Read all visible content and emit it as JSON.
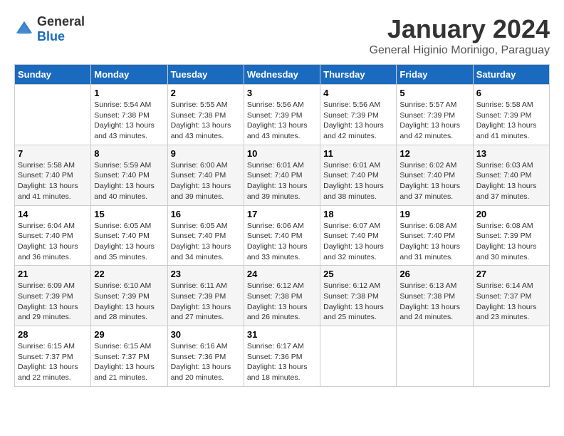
{
  "logo": {
    "general": "General",
    "blue": "Blue"
  },
  "title": "January 2024",
  "subtitle": "General Higinio Morinigo, Paraguay",
  "days_header": [
    "Sunday",
    "Monday",
    "Tuesday",
    "Wednesday",
    "Thursday",
    "Friday",
    "Saturday"
  ],
  "weeks": [
    [
      {
        "day": "",
        "info": ""
      },
      {
        "day": "1",
        "info": "Sunrise: 5:54 AM\nSunset: 7:38 PM\nDaylight: 13 hours\nand 43 minutes."
      },
      {
        "day": "2",
        "info": "Sunrise: 5:55 AM\nSunset: 7:38 PM\nDaylight: 13 hours\nand 43 minutes."
      },
      {
        "day": "3",
        "info": "Sunrise: 5:56 AM\nSunset: 7:39 PM\nDaylight: 13 hours\nand 43 minutes."
      },
      {
        "day": "4",
        "info": "Sunrise: 5:56 AM\nSunset: 7:39 PM\nDaylight: 13 hours\nand 42 minutes."
      },
      {
        "day": "5",
        "info": "Sunrise: 5:57 AM\nSunset: 7:39 PM\nDaylight: 13 hours\nand 42 minutes."
      },
      {
        "day": "6",
        "info": "Sunrise: 5:58 AM\nSunset: 7:39 PM\nDaylight: 13 hours\nand 41 minutes."
      }
    ],
    [
      {
        "day": "7",
        "info": "Sunrise: 5:58 AM\nSunset: 7:40 PM\nDaylight: 13 hours\nand 41 minutes."
      },
      {
        "day": "8",
        "info": "Sunrise: 5:59 AM\nSunset: 7:40 PM\nDaylight: 13 hours\nand 40 minutes."
      },
      {
        "day": "9",
        "info": "Sunrise: 6:00 AM\nSunset: 7:40 PM\nDaylight: 13 hours\nand 39 minutes."
      },
      {
        "day": "10",
        "info": "Sunrise: 6:01 AM\nSunset: 7:40 PM\nDaylight: 13 hours\nand 39 minutes."
      },
      {
        "day": "11",
        "info": "Sunrise: 6:01 AM\nSunset: 7:40 PM\nDaylight: 13 hours\nand 38 minutes."
      },
      {
        "day": "12",
        "info": "Sunrise: 6:02 AM\nSunset: 7:40 PM\nDaylight: 13 hours\nand 37 minutes."
      },
      {
        "day": "13",
        "info": "Sunrise: 6:03 AM\nSunset: 7:40 PM\nDaylight: 13 hours\nand 37 minutes."
      }
    ],
    [
      {
        "day": "14",
        "info": "Sunrise: 6:04 AM\nSunset: 7:40 PM\nDaylight: 13 hours\nand 36 minutes."
      },
      {
        "day": "15",
        "info": "Sunrise: 6:05 AM\nSunset: 7:40 PM\nDaylight: 13 hours\nand 35 minutes."
      },
      {
        "day": "16",
        "info": "Sunrise: 6:05 AM\nSunset: 7:40 PM\nDaylight: 13 hours\nand 34 minutes."
      },
      {
        "day": "17",
        "info": "Sunrise: 6:06 AM\nSunset: 7:40 PM\nDaylight: 13 hours\nand 33 minutes."
      },
      {
        "day": "18",
        "info": "Sunrise: 6:07 AM\nSunset: 7:40 PM\nDaylight: 13 hours\nand 32 minutes."
      },
      {
        "day": "19",
        "info": "Sunrise: 6:08 AM\nSunset: 7:40 PM\nDaylight: 13 hours\nand 31 minutes."
      },
      {
        "day": "20",
        "info": "Sunrise: 6:08 AM\nSunset: 7:39 PM\nDaylight: 13 hours\nand 30 minutes."
      }
    ],
    [
      {
        "day": "21",
        "info": "Sunrise: 6:09 AM\nSunset: 7:39 PM\nDaylight: 13 hours\nand 29 minutes."
      },
      {
        "day": "22",
        "info": "Sunrise: 6:10 AM\nSunset: 7:39 PM\nDaylight: 13 hours\nand 28 minutes."
      },
      {
        "day": "23",
        "info": "Sunrise: 6:11 AM\nSunset: 7:39 PM\nDaylight: 13 hours\nand 27 minutes."
      },
      {
        "day": "24",
        "info": "Sunrise: 6:12 AM\nSunset: 7:38 PM\nDaylight: 13 hours\nand 26 minutes."
      },
      {
        "day": "25",
        "info": "Sunrise: 6:12 AM\nSunset: 7:38 PM\nDaylight: 13 hours\nand 25 minutes."
      },
      {
        "day": "26",
        "info": "Sunrise: 6:13 AM\nSunset: 7:38 PM\nDaylight: 13 hours\nand 24 minutes."
      },
      {
        "day": "27",
        "info": "Sunrise: 6:14 AM\nSunset: 7:37 PM\nDaylight: 13 hours\nand 23 minutes."
      }
    ],
    [
      {
        "day": "28",
        "info": "Sunrise: 6:15 AM\nSunset: 7:37 PM\nDaylight: 13 hours\nand 22 minutes."
      },
      {
        "day": "29",
        "info": "Sunrise: 6:15 AM\nSunset: 7:37 PM\nDaylight: 13 hours\nand 21 minutes."
      },
      {
        "day": "30",
        "info": "Sunrise: 6:16 AM\nSunset: 7:36 PM\nDaylight: 13 hours\nand 20 minutes."
      },
      {
        "day": "31",
        "info": "Sunrise: 6:17 AM\nSunset: 7:36 PM\nDaylight: 13 hours\nand 18 minutes."
      },
      {
        "day": "",
        "info": ""
      },
      {
        "day": "",
        "info": ""
      },
      {
        "day": "",
        "info": ""
      }
    ]
  ]
}
